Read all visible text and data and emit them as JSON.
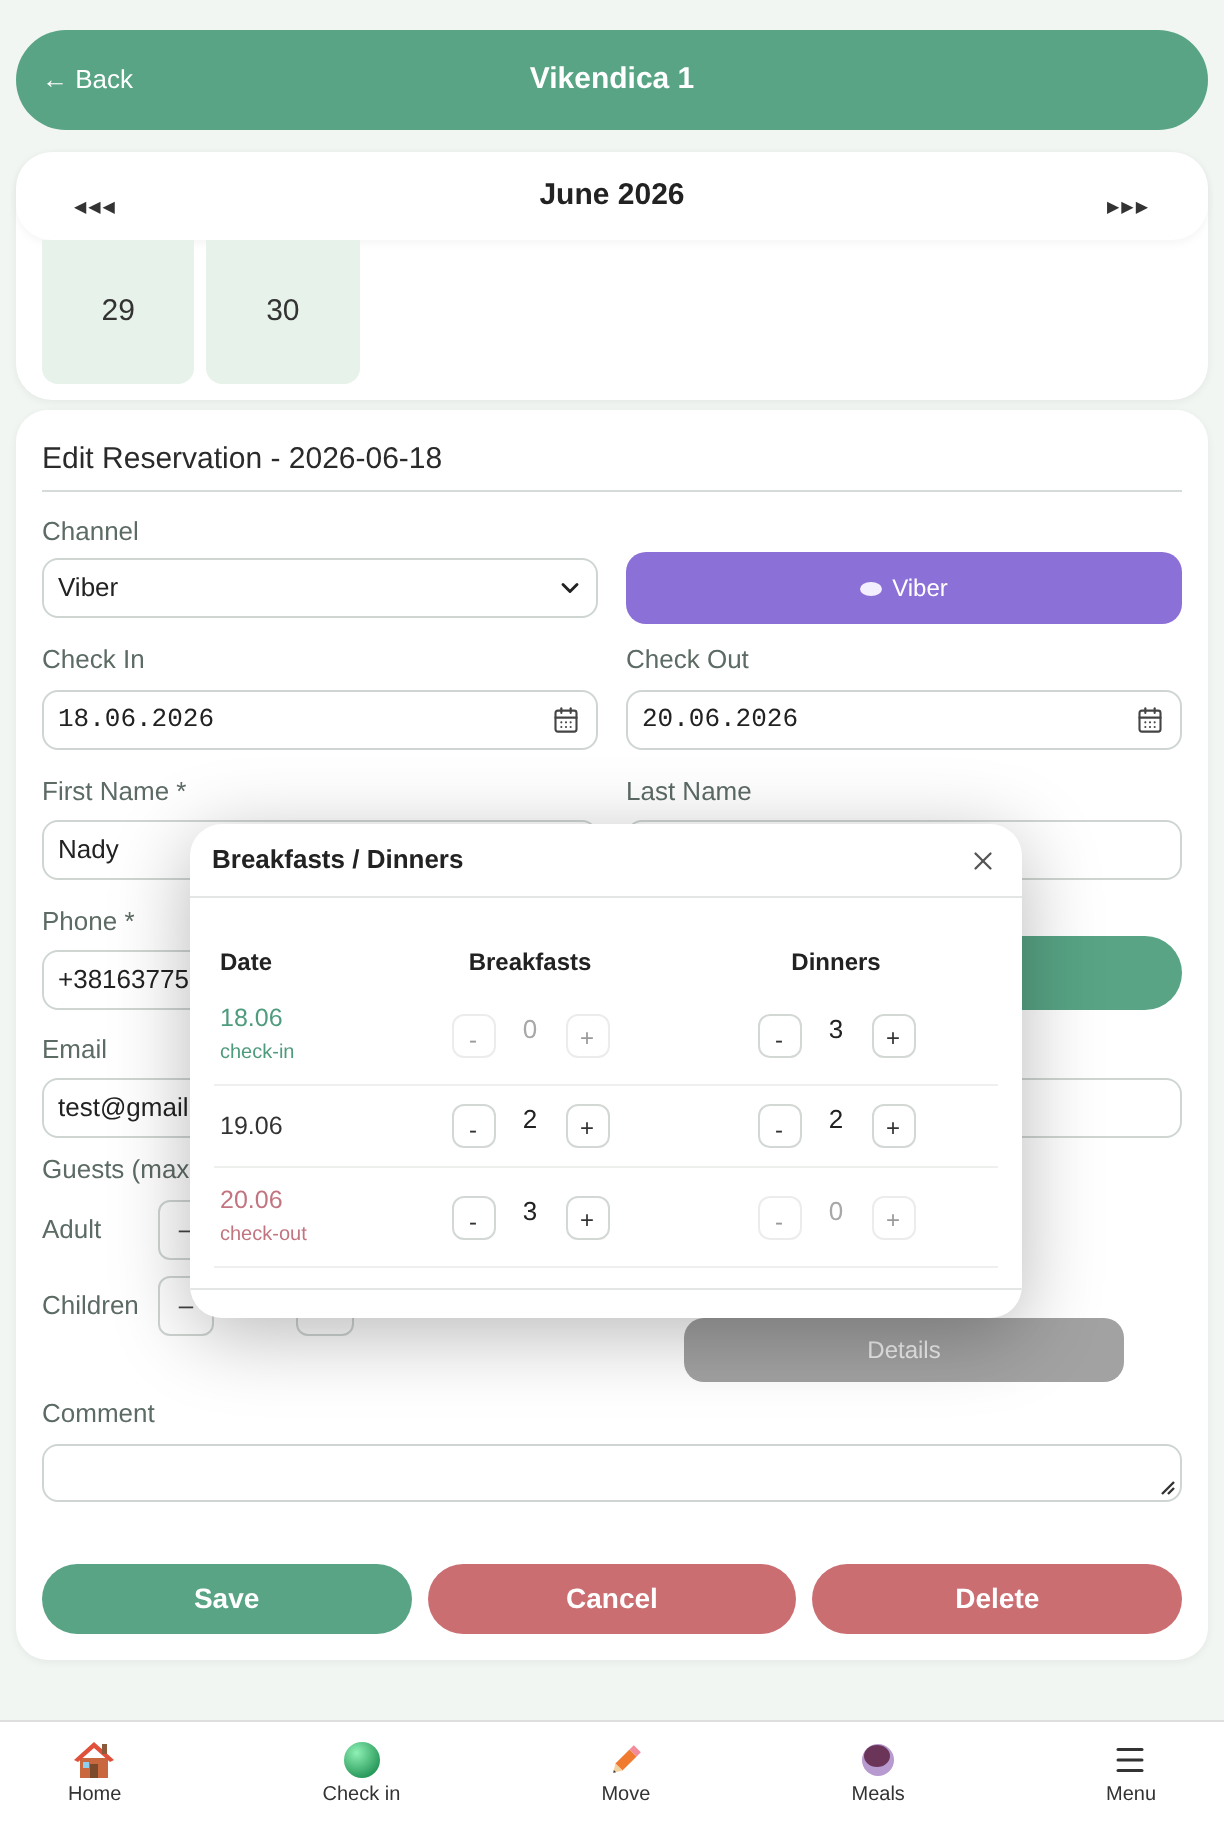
{
  "header": {
    "back": "← Back",
    "title": "Vikendica 1"
  },
  "calendar": {
    "prev": "◀◀◀",
    "month": "June 2026",
    "next": "▶▶▶",
    "days": [
      "29",
      "30"
    ]
  },
  "form": {
    "title": "Edit Reservation - 2026-06-18",
    "channel": {
      "label": "Channel",
      "value": "Viber",
      "badge": "Viber"
    },
    "check_in": {
      "label": "Check In",
      "value": "18.06.2026"
    },
    "check_out": {
      "label": "Check Out",
      "value": "20.06.2026"
    },
    "first_name": {
      "label": "First Name *",
      "value": "Nady"
    },
    "last_name": {
      "label": "Last Name"
    },
    "phone": {
      "label": "Phone *",
      "value": "+38163775"
    },
    "email": {
      "label": "Email",
      "value": "test@gmail"
    },
    "guests": {
      "label": "Guests (max",
      "rows": [
        {
          "label": "Adult",
          "minus": "–"
        },
        {
          "label": "Children",
          "minus": "–"
        }
      ]
    },
    "details_button": "Details",
    "comment": {
      "label": "Comment"
    },
    "buttons": [
      {
        "label": "Save",
        "kind": "primary"
      },
      {
        "label": "Cancel",
        "kind": "danger"
      },
      {
        "label": "Delete",
        "kind": "danger"
      }
    ]
  },
  "modal": {
    "title": "Breakfasts / Dinners",
    "columns": [
      "Date",
      "Breakfasts",
      "Dinners"
    ],
    "rows": [
      {
        "date": "18.06",
        "note": "check-in",
        "kind": "check_in",
        "breakfasts": {
          "minus": "-",
          "value": "0",
          "plus": "+",
          "disabled": true
        },
        "dinners": {
          "minus": "-",
          "value": "3",
          "plus": "+",
          "disabled": false
        }
      },
      {
        "date": "19.06",
        "kind": "stay",
        "breakfasts": {
          "minus": "-",
          "value": "2",
          "plus": "+",
          "disabled": false
        },
        "dinners": {
          "minus": "-",
          "value": "2",
          "plus": "+",
          "disabled": false
        }
      },
      {
        "date": "20.06",
        "note": "check-out",
        "kind": "check_out",
        "breakfasts": {
          "minus": "-",
          "value": "3",
          "plus": "+",
          "disabled": false
        },
        "dinners": {
          "minus": "-",
          "value": "0",
          "plus": "+",
          "disabled": true
        }
      }
    ]
  },
  "nav": [
    {
      "label": "Home"
    },
    {
      "label": "Check in"
    },
    {
      "label": "Move"
    },
    {
      "label": "Meals"
    },
    {
      "label": "Menu"
    }
  ]
}
